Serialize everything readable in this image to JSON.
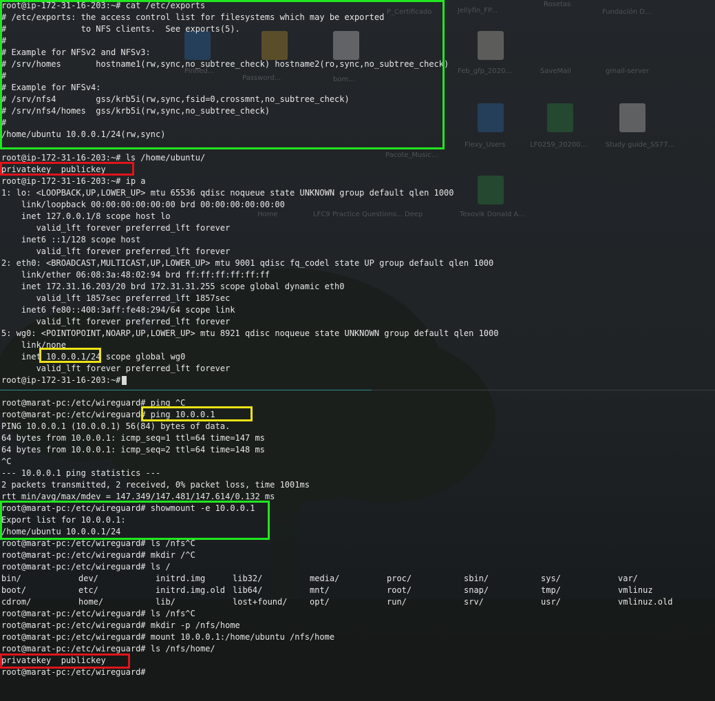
{
  "theme": {
    "background": "#1e2024",
    "text": "#e7e7e7",
    "green_box": "#21e621",
    "red_box": "#e0141b",
    "yellow_box": "#ece316"
  },
  "desktop": {
    "labels": [
      "P_Certificado",
      "Jellyfin_FP...",
      "Rosetas",
      "Fundación D...",
      "Feb_gfp_2020...",
      "SaveMail",
      "gmail-server",
      "Pinned...",
      "Password...",
      "bom...",
      "Pacote_Music...",
      "Flexy_Users",
      "LF0259_20200...",
      "Study guide_SS77...",
      "Home",
      "LFC9 Practice Questions...",
      "Deep",
      "Texovik Donald A..."
    ]
  },
  "top_terminal": {
    "lines": [
      "root@ip-172-31-16-203:~# cat /etc/exports",
      "# /etc/exports: the access control list for filesystems which may be exported",
      "#               to NFS clients.  See exports(5).",
      "#",
      "# Example for NFSv2 and NFSv3:",
      "# /srv/homes       hostname1(rw,sync,no_subtree_check) hostname2(ro,sync,no_subtree_check)",
      "#",
      "# Example for NFSv4:",
      "# /srv/nfs4        gss/krb5i(rw,sync,fsid=0,crossmnt,no_subtree_check)",
      "# /srv/nfs4/homes  gss/krb5i(rw,sync,no_subtree_check)",
      "#",
      "/home/ubuntu 10.0.0.1/24(rw,sync)",
      "",
      "root@ip-172-31-16-203:~# ls /home/ubuntu/",
      "privatekey  publickey",
      "root@ip-172-31-16-203:~# ip a",
      "1: lo: <LOOPBACK,UP,LOWER_UP> mtu 65536 qdisc noqueue state UNKNOWN group default qlen 1000",
      "    link/loopback 00:00:00:00:00:00 brd 00:00:00:00:00:00",
      "    inet 127.0.0.1/8 scope host lo",
      "       valid_lft forever preferred_lft forever",
      "    inet6 ::1/128 scope host",
      "       valid_lft forever preferred_lft forever",
      "2: eth0: <BROADCAST,MULTICAST,UP,LOWER_UP> mtu 9001 qdisc fq_codel state UP group default qlen 1000",
      "    link/ether 06:08:3a:48:02:94 brd ff:ff:ff:ff:ff:ff",
      "    inet 172.31.16.203/20 brd 172.31.31.255 scope global dynamic eth0",
      "       valid_lft 1857sec preferred_lft 1857sec",
      "    inet6 fe80::408:3aff:fe48:294/64 scope link",
      "       valid_lft forever preferred_lft forever",
      "5: wg0: <POINTOPOINT,NOARP,UP,LOWER_UP> mtu 8921 qdisc noqueue state UNKNOWN group default qlen 1000",
      "    link/none",
      "    inet 10.0.0.1/24 scope global wg0",
      "       valid_lft forever preferred_lft forever",
      "root@ip-172-31-16-203:~# "
    ]
  },
  "bottom_terminal": {
    "lines_before_ls": [
      "root@marat-pc:/etc/wireguard# ping ^C",
      "root@marat-pc:/etc/wireguard# ping 10.0.0.1",
      "PING 10.0.0.1 (10.0.0.1) 56(84) bytes of data.",
      "64 bytes from 10.0.0.1: icmp_seq=1 ttl=64 time=147 ms",
      "64 bytes from 10.0.0.1: icmp_seq=2 ttl=64 time=148 ms",
      "^C",
      "--- 10.0.0.1 ping statistics ---",
      "2 packets transmitted, 2 received, 0% packet loss, time 1001ms",
      "rtt min/avg/max/mdev = 147.349/147.481/147.614/0.132 ms",
      "root@marat-pc:/etc/wireguard# showmount -e 10.0.0.1",
      "Export list for 10.0.0.1:",
      "/home/ubuntu 10.0.0.1/24",
      "root@marat-pc:/etc/wireguard# ls /nfs^C",
      "root@marat-pc:/etc/wireguard# mkdir /^C",
      "root@marat-pc:/etc/wireguard# ls /"
    ],
    "ls_columns": [
      [
        "bin/",
        "boot/",
        "cdrom/"
      ],
      [
        "dev/",
        "etc/",
        "home/"
      ],
      [
        "initrd.img",
        "initrd.img.old",
        "lib/"
      ],
      [
        "lib32/",
        "lib64/",
        "lost+found/"
      ],
      [
        "media/",
        "mnt/",
        "opt/"
      ],
      [
        "proc/",
        "root/",
        "run/"
      ],
      [
        "sbin/",
        "snap/",
        "srv/"
      ],
      [
        "sys/",
        "tmp/",
        "usr/"
      ],
      [
        "var/",
        "vmlinuz",
        "vmlinuz.old"
      ]
    ],
    "lines_after_ls": [
      "root@marat-pc:/etc/wireguard# ls /nfs^C",
      "root@marat-pc:/etc/wireguard# mkdir -p /nfs/home",
      "root@marat-pc:/etc/wireguard# mount 10.0.0.1:/home/ubuntu /nfs/home",
      "root@marat-pc:/etc/wireguard# ls /nfs/home/",
      "privatekey  publickey",
      "root@marat-pc:/etc/wireguard# "
    ]
  }
}
